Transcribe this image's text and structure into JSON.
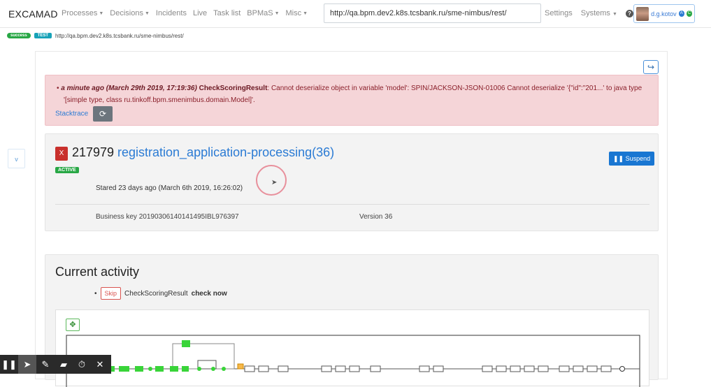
{
  "header": {
    "brand": "EXCAMAD",
    "nav": [
      {
        "label": "Processes",
        "caret": true
      },
      {
        "label": "Decisions",
        "caret": true
      },
      {
        "label": "Incidents",
        "caret": false
      },
      {
        "label": "Live",
        "caret": false
      },
      {
        "label": "Task list",
        "caret": false
      },
      {
        "label": "BPMaS",
        "caret": true
      },
      {
        "label": "Misc",
        "caret": true
      }
    ],
    "url_value": "http://qa.bpm.dev2.k8s.tcsbank.ru/sme-nimbus/rest/",
    "settings": "Settings",
    "systems": "Systems",
    "help": "?",
    "user": {
      "name": "d.g.kotov",
      "badge1": "A",
      "badge2": "C"
    }
  },
  "env": {
    "tag1": "success",
    "tag2": "TEST",
    "url": "http://qa.bpm.dev2.k8s.tcsbank.ru/sme-nimbus/rest/"
  },
  "alert": {
    "time": "a minute ago (March 29th 2019, 17:19:36)",
    "task": "CheckScoringResult",
    "message": ": Cannot deserialize object in variable 'model': SPIN/JACKSON-JSON-01006 Cannot deserialize '{\"id\":\"201...' to java type '[simple type, class ru.tinkoff.bpm.smenimbus.domain.Model]'.",
    "stacktrace": "Stacktrace"
  },
  "instance": {
    "x_label": "X",
    "id": "217979",
    "name": "registration_application-processing(36)",
    "status": "ACTIVE",
    "suspend_label": "Suspend",
    "started": "Stared 23 days ago (March 6th 2019, 16:26:02)",
    "business_key": "Business key 20190306140141495IBL976397",
    "version": "Version 36"
  },
  "side_toggle": "v",
  "current": {
    "title": "Current activity",
    "skip_label": "Skip",
    "activity_name": "CheckScoringResult",
    "activity_action": "check now"
  },
  "colors": {
    "accent": "#2b7bd4",
    "danger": "#c9302c",
    "success": "#28a745",
    "diagram_active": "#39d439"
  }
}
